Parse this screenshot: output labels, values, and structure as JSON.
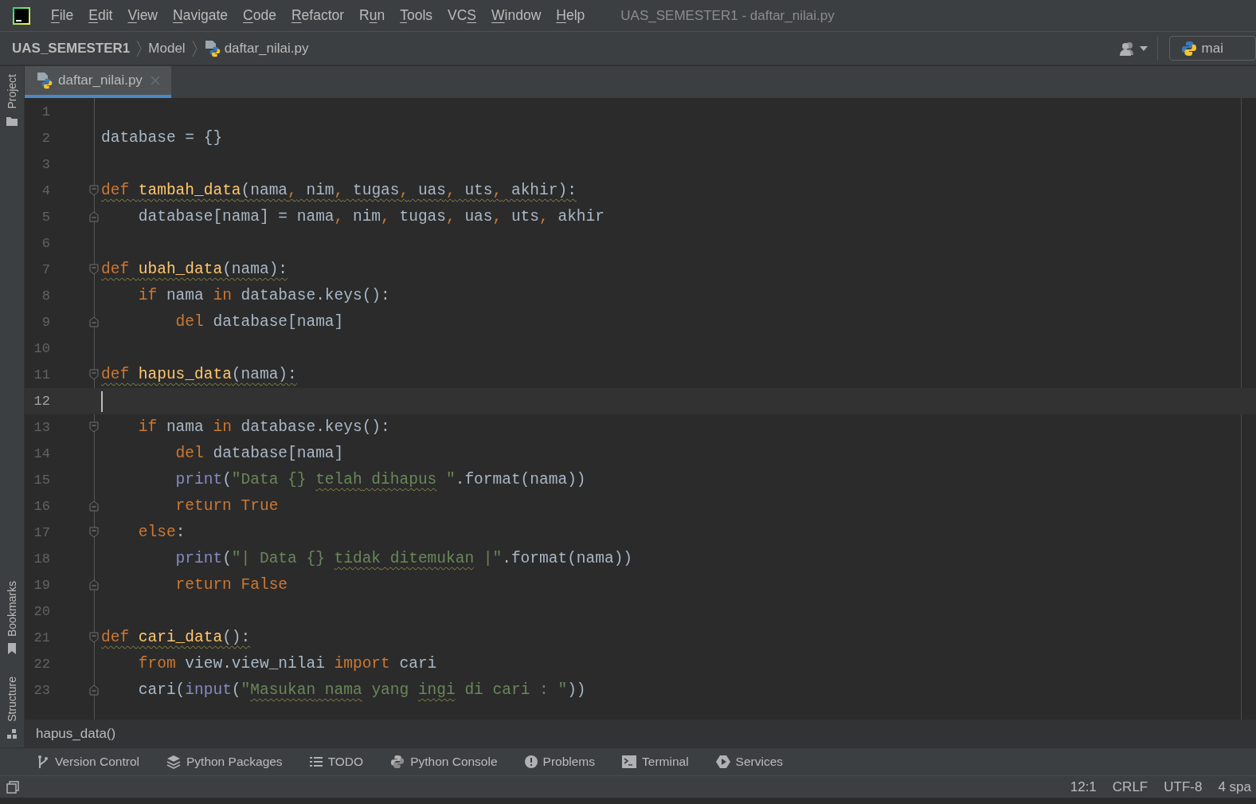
{
  "menu": [
    {
      "key": "F",
      "after": "ile"
    },
    {
      "key": "E",
      "after": "dit"
    },
    {
      "key": "V",
      "after": "iew"
    },
    {
      "key": "N",
      "after": "avigate"
    },
    {
      "key": "C",
      "after": "ode"
    },
    {
      "key": "R",
      "after": "efactor"
    },
    {
      "before": "R",
      "key": "u",
      "after": "n"
    },
    {
      "key": "T",
      "after": "ools"
    },
    {
      "before": "VC",
      "key": "S"
    },
    {
      "key": "W",
      "after": "indow"
    },
    {
      "key": "H",
      "after": "elp"
    }
  ],
  "window": {
    "title": "UAS_SEMESTER1 - daftar_nilai.py"
  },
  "breadcrumbs": [
    "UAS_SEMESTER1",
    "Model",
    "daftar_nilai.py"
  ],
  "run_config": {
    "label": "mai"
  },
  "side_tools": {
    "top": [
      "Project"
    ],
    "bottom": [
      "Bookmarks",
      "Structure"
    ]
  },
  "tabs": [
    {
      "label": "daftar_nilai.py",
      "selected": true
    }
  ],
  "lines": [
    {
      "number": "1",
      "current": false,
      "fold_open": false,
      "fold_close": false
    },
    {
      "number": "2",
      "current": false,
      "fold_open": false,
      "fold_close": false,
      "tokens": [
        {
          "text": "database = {}",
          "kind": "plain",
          "warned": false
        }
      ]
    },
    {
      "number": "3",
      "current": false,
      "fold_open": false,
      "fold_close": false
    },
    {
      "number": "4",
      "current": false,
      "fold_open": true,
      "fold_close": false,
      "tokens": [
        {
          "text": "def ",
          "kind": "kw",
          "warned": true
        },
        {
          "text": "tambah_data",
          "kind": "fn",
          "warned": true
        },
        {
          "text": "(nama",
          "kind": "plain",
          "warned": true
        },
        {
          "text": ",",
          "kind": "kw",
          "warned": true
        },
        {
          "text": " nim",
          "kind": "plain",
          "warned": true
        },
        {
          "text": ",",
          "kind": "kw",
          "warned": true
        },
        {
          "text": " tugas",
          "kind": "plain",
          "warned": true
        },
        {
          "text": ",",
          "kind": "kw",
          "warned": true
        },
        {
          "text": " uas",
          "kind": "plain",
          "warned": true
        },
        {
          "text": ",",
          "kind": "kw",
          "warned": true
        },
        {
          "text": " uts",
          "kind": "plain",
          "warned": true
        },
        {
          "text": ",",
          "kind": "kw",
          "warned": true
        },
        {
          "text": " akhir):",
          "kind": "plain",
          "warned": true
        }
      ]
    },
    {
      "number": "5",
      "current": false,
      "fold_open": false,
      "fold_close": true,
      "tokens": [
        {
          "text": "    database[nama] = nama",
          "kind": "plain",
          "warned": false
        },
        {
          "text": ",",
          "kind": "kw",
          "warned": false
        },
        {
          "text": " nim",
          "kind": "plain",
          "warned": false
        },
        {
          "text": ",",
          "kind": "kw",
          "warned": false
        },
        {
          "text": " tugas",
          "kind": "plain",
          "warned": false
        },
        {
          "text": ",",
          "kind": "kw",
          "warned": false
        },
        {
          "text": " uas",
          "kind": "plain",
          "warned": false
        },
        {
          "text": ",",
          "kind": "kw",
          "warned": false
        },
        {
          "text": " uts",
          "kind": "plain",
          "warned": false
        },
        {
          "text": ",",
          "kind": "kw",
          "warned": false
        },
        {
          "text": " akhir",
          "kind": "plain",
          "warned": false
        }
      ]
    },
    {
      "number": "6",
      "current": false,
      "fold_open": false,
      "fold_close": false
    },
    {
      "number": "7",
      "current": false,
      "fold_open": true,
      "fold_close": false,
      "tokens": [
        {
          "text": "def ",
          "kind": "kw",
          "warned": true
        },
        {
          "text": "ubah_data",
          "kind": "fn",
          "warned": true
        },
        {
          "text": "(nama):",
          "kind": "plain",
          "warned": true
        }
      ]
    },
    {
      "number": "8",
      "current": false,
      "fold_open": false,
      "fold_close": false,
      "tokens": [
        {
          "text": "    if ",
          "kind": "kw",
          "warned": false
        },
        {
          "text": "nama ",
          "kind": "plain",
          "warned": false
        },
        {
          "text": "in ",
          "kind": "kw",
          "warned": false
        },
        {
          "text": "database.keys():",
          "kind": "plain",
          "warned": false
        }
      ]
    },
    {
      "number": "9",
      "current": false,
      "fold_open": false,
      "fold_close": true,
      "tokens": [
        {
          "text": "        del ",
          "kind": "kw",
          "warned": false
        },
        {
          "text": "database[nama]",
          "kind": "plain",
          "warned": false
        }
      ]
    },
    {
      "number": "10",
      "current": false,
      "fold_open": false,
      "fold_close": false
    },
    {
      "number": "11",
      "current": false,
      "fold_open": true,
      "fold_close": false,
      "tokens": [
        {
          "text": "def ",
          "kind": "kw",
          "warned": true
        },
        {
          "text": "hapus_data",
          "kind": "fn",
          "warned": true
        },
        {
          "text": "(nama):",
          "kind": "plain",
          "warned": true
        }
      ]
    },
    {
      "number": "12",
      "current": true,
      "fold_open": false,
      "fold_close": false
    },
    {
      "number": "13",
      "current": false,
      "fold_open": true,
      "fold_close": false,
      "tokens": [
        {
          "text": "    if ",
          "kind": "kw",
          "warned": false
        },
        {
          "text": "nama ",
          "kind": "plain",
          "warned": false
        },
        {
          "text": "in ",
          "kind": "kw",
          "warned": false
        },
        {
          "text": "database.keys():",
          "kind": "plain",
          "warned": false
        }
      ]
    },
    {
      "number": "14",
      "current": false,
      "fold_open": false,
      "fold_close": false,
      "tokens": [
        {
          "text": "        del ",
          "kind": "kw",
          "warned": false
        },
        {
          "text": "database[nama]",
          "kind": "plain",
          "warned": false
        }
      ]
    },
    {
      "number": "15",
      "current": false,
      "fold_open": false,
      "fold_close": false,
      "tokens": [
        {
          "text": "        print",
          "kind": "builtin",
          "warned": false
        },
        {
          "text": "(",
          "kind": "plain",
          "warned": false
        },
        {
          "text": "\"Data {} ",
          "kind": "str",
          "warned": false
        },
        {
          "text": "telah",
          "kind": "str",
          "warned": true
        },
        {
          "text": " dihapus",
          "kind": "str",
          "warned": true
        },
        {
          "text": " \"",
          "kind": "str",
          "warned": false
        },
        {
          "text": ".format(nama))",
          "kind": "plain",
          "warned": false
        }
      ]
    },
    {
      "number": "16",
      "current": false,
      "fold_open": false,
      "fold_close": true,
      "tokens": [
        {
          "text": "        return True",
          "kind": "kw",
          "warned": false
        }
      ]
    },
    {
      "number": "17",
      "current": false,
      "fold_open": true,
      "fold_close": false,
      "tokens": [
        {
          "text": "    else",
          "kind": "kw",
          "warned": false
        },
        {
          "text": ":",
          "kind": "plain",
          "warned": false
        }
      ]
    },
    {
      "number": "18",
      "current": false,
      "fold_open": false,
      "fold_close": false,
      "tokens": [
        {
          "text": "        print",
          "kind": "builtin",
          "warned": false
        },
        {
          "text": "(",
          "kind": "plain",
          "warned": false
        },
        {
          "text": "\"| Data {} ",
          "kind": "str",
          "warned": false
        },
        {
          "text": "tidak",
          "kind": "str",
          "warned": true
        },
        {
          "text": " ditemukan",
          "kind": "str",
          "warned": true
        },
        {
          "text": " |\"",
          "kind": "str",
          "warned": false
        },
        {
          "text": ".format(nama))",
          "kind": "plain",
          "warned": false
        }
      ]
    },
    {
      "number": "19",
      "current": false,
      "fold_open": false,
      "fold_close": true,
      "tokens": [
        {
          "text": "        return False",
          "kind": "kw",
          "warned": false
        }
      ]
    },
    {
      "number": "20",
      "current": false,
      "fold_open": false,
      "fold_close": false
    },
    {
      "number": "21",
      "current": false,
      "fold_open": true,
      "fold_close": false,
      "tokens": [
        {
          "text": "def ",
          "kind": "kw",
          "warned": true
        },
        {
          "text": "cari_data",
          "kind": "fn",
          "warned": true
        },
        {
          "text": "():",
          "kind": "plain",
          "warned": true
        }
      ]
    },
    {
      "number": "22",
      "current": false,
      "fold_open": false,
      "fold_close": false,
      "tokens": [
        {
          "text": "    from ",
          "kind": "kw",
          "warned": false
        },
        {
          "text": "view.view_nilai ",
          "kind": "plain",
          "warned": false
        },
        {
          "text": "import ",
          "kind": "kw",
          "warned": false
        },
        {
          "text": "cari",
          "kind": "plain",
          "warned": false
        }
      ]
    },
    {
      "number": "23",
      "current": false,
      "fold_open": false,
      "fold_close": true,
      "tokens": [
        {
          "text": "    cari(",
          "kind": "plain",
          "warned": false
        },
        {
          "text": "input",
          "kind": "builtin",
          "warned": false
        },
        {
          "text": "(",
          "kind": "plain",
          "warned": false
        },
        {
          "text": "\"",
          "kind": "str",
          "warned": false
        },
        {
          "text": "Masukan",
          "kind": "str",
          "warned": true
        },
        {
          "text": " nama",
          "kind": "str",
          "warned": true
        },
        {
          "text": " yang ",
          "kind": "str",
          "warned": false
        },
        {
          "text": "ingi",
          "kind": "str",
          "warned": true
        },
        {
          "text": " di cari : \"",
          "kind": "str",
          "warned": false
        },
        {
          "text": "))",
          "kind": "plain",
          "warned": false
        }
      ]
    }
  ],
  "nav_bar": {
    "crumb": "hapus_data()"
  },
  "tool_windows": [
    "Version Control",
    "Python Packages",
    "TODO",
    "Python Console",
    "Problems",
    "Terminal",
    "Services"
  ],
  "status_bar": [
    "12:1",
    "CRLF",
    "UTF-8",
    "4 spa"
  ]
}
